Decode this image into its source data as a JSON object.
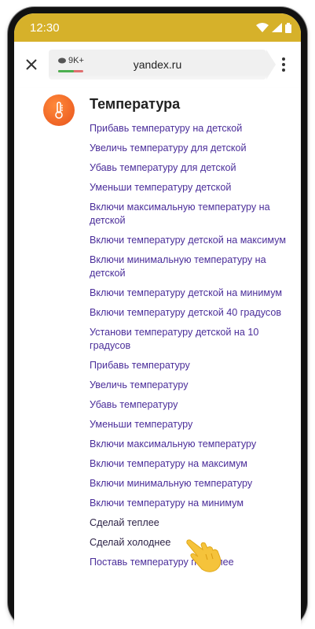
{
  "status_bar": {
    "time": "12:30",
    "bg_color": "#d6b12a",
    "icons": [
      "wifi-icon",
      "signal-icon",
      "battery-icon"
    ]
  },
  "browser": {
    "tab_count_badge": "9K+",
    "url": "yandex.ru"
  },
  "section": {
    "title": "Температура",
    "icon": "thermometer-icon",
    "accent": "#e8531c",
    "link_color": "#4b2e9a",
    "commands": [
      "Прибавь температуру на детской",
      "Увеличь температуру для детской",
      "Убавь температуру для детской",
      "Уменьши температуру детской",
      "Включи максимальную температуру на детской",
      "Включи температуру детской на максимум",
      "Включи минимальную температуру на детской",
      "Включи температуру детской на минимум",
      "Включи температуру детской 40 градусов",
      "Установи температуру детской на 10 градусов",
      "Прибавь температуру",
      "Увеличь температуру",
      "Убавь температуру",
      "Уменьши температуру",
      "Включи максимальную температуру",
      "Включи температуру на максимум",
      "Включи минимальную температуру",
      "Включи температуру на минимум",
      "Сделай теплее",
      "Сделай холоднее",
      "Поставь температуру потеплее"
    ]
  }
}
